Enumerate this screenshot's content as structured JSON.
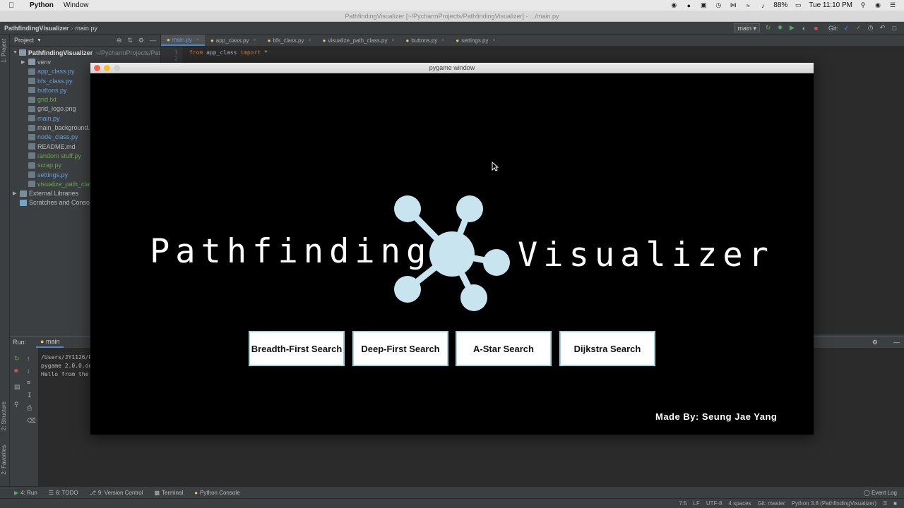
{
  "menubar": {
    "app": "Python",
    "menu": "Window",
    "battery": "88%",
    "clock": "Tue 11:10 PM"
  },
  "ide": {
    "title": "PathfindingVisualizer [~/PycharmProjects/PathfindingVisualizer] - .../main.py",
    "breadcrumb": [
      "PathfindingVisualizer",
      "main.py"
    ],
    "run_config": "main",
    "git_label": "Git:",
    "project_label": "Project",
    "tabs": [
      "main.py",
      "app_class.py",
      "bfs_class.py",
      "visualize_path_class.py",
      "buttons.py",
      "settings.py"
    ],
    "root": {
      "name": "PathfindingVisualizer",
      "path": "~/PycharmProjects/Pat"
    },
    "tree": [
      {
        "name": "venv",
        "color": "grey",
        "folder": true
      },
      {
        "name": "app_class.py",
        "color": "blue"
      },
      {
        "name": "bfs_class.py",
        "color": "blue"
      },
      {
        "name": "buttons.py",
        "color": "blue"
      },
      {
        "name": "grid.txt",
        "color": "green"
      },
      {
        "name": "grid_logo.png",
        "color": "grey"
      },
      {
        "name": "main.py",
        "color": "blue"
      },
      {
        "name": "main_background.",
        "color": "grey"
      },
      {
        "name": "node_class.py",
        "color": "blue"
      },
      {
        "name": "README.md",
        "color": "grey"
      },
      {
        "name": "random stuff.py",
        "color": "green"
      },
      {
        "name": "scrap.py",
        "color": "green"
      },
      {
        "name": "settings.py",
        "color": "blue"
      },
      {
        "name": "visualize_path_clas",
        "color": "green"
      }
    ],
    "external": "External Libraries",
    "scratches": "Scratches and Conso",
    "code_line": {
      "kw1": "from",
      "mod": "app_class",
      "kw2": "import",
      "star": "*"
    },
    "gutter": [
      "1",
      "2"
    ],
    "run_label": "Run:",
    "run_tab": "main",
    "console": [
      "/Users/JY1126/P",
      "pygame 2.0.0.de",
      "Hello from the"
    ],
    "toolwindows": [
      "4: Run",
      "6: TODO",
      "9: Version Control",
      "Terminal",
      "Python Console"
    ],
    "event_log": "Event Log",
    "status": [
      "7:5",
      "LF",
      "UTF-8",
      "4 spaces",
      "Git: master",
      "Python 3.8 (PathfindingVisualizer)"
    ],
    "left_tabs": [
      "1: Project",
      "2: Structure",
      "2: Favorites"
    ]
  },
  "pygame": {
    "title": "pygame window",
    "word_left": "Pathfinding",
    "word_right": "Visualizer",
    "buttons": [
      "Breadth-First Search",
      "Deep-First Search",
      "A-Star Search",
      "Dijkstra Search"
    ],
    "credit": "Made By: Seung Jae Yang",
    "logo_color": "#c7e4ef"
  },
  "colors": {
    "accent": "#4a88c7",
    "button_border": "#9fd3dd"
  }
}
